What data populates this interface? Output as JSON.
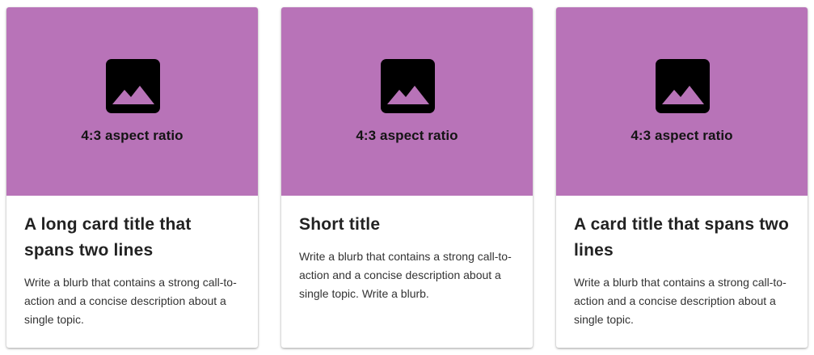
{
  "colors": {
    "media_bg": "#b873b8",
    "icon": "#000000",
    "card_bg": "#ffffff"
  },
  "cards": [
    {
      "media_icon": "image-placeholder-icon",
      "media_caption": "4:3 aspect ratio",
      "title": "A long card title that spans two lines",
      "blurb": "Write a blurb that contains a strong call-to-action and a concise description about a single topic."
    },
    {
      "media_icon": "image-placeholder-icon",
      "media_caption": "4:3 aspect ratio",
      "title": "Short title",
      "blurb": "Write a blurb that contains a strong call-to-action and a concise description about a single topic. Write a blurb."
    },
    {
      "media_icon": "image-placeholder-icon",
      "media_caption": "4:3 aspect ratio",
      "title": "A card title that spans two lines",
      "blurb": "Write a blurb that contains a strong call-to-action and a concise description about a single topic."
    }
  ]
}
